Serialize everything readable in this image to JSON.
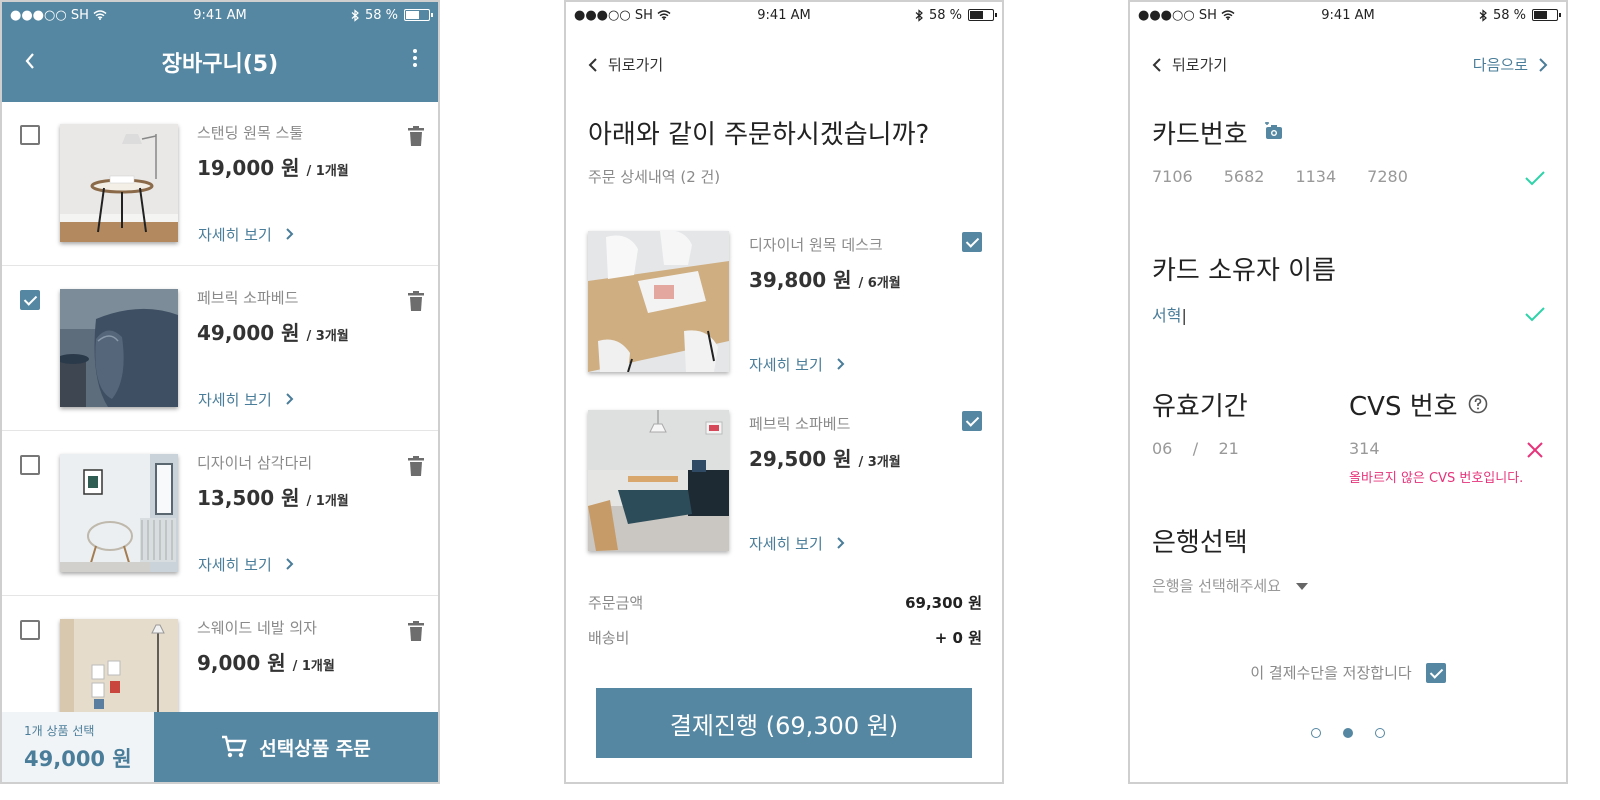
{
  "status_bar": {
    "carrier": "●●●○○ SH",
    "time": "9:41 AM",
    "battery": "58 %"
  },
  "cart": {
    "title": "장바구니(5)",
    "items": [
      {
        "name": "스탠딩 원목 스툴",
        "price": "19,000 원",
        "period": "/ 1개월",
        "detail": "자세히 보기",
        "checked": false
      },
      {
        "name": "페브릭 소파베드",
        "price": "49,000 원",
        "period": "/ 3개월",
        "detail": "자세히 보기",
        "checked": true
      },
      {
        "name": "디자이너 삼각다리",
        "price": "13,500 원",
        "period": "/ 1개월",
        "detail": "자세히 보기",
        "checked": false
      },
      {
        "name": "스웨이드 네발 의자",
        "price": "9,000 원",
        "period": "/ 1개월",
        "detail": "",
        "checked": false
      }
    ],
    "footer": {
      "selected_count": "1개 상품 선택",
      "selected_total": "49,000 원",
      "order_button": "선택상품 주문"
    }
  },
  "confirm": {
    "back": "뒤로가기",
    "heading": "아래와 같이 주문하시겠습니까?",
    "subheading": "주문 상세내역 (2 건)",
    "items": [
      {
        "name": "디자이너 원목 데스크",
        "price": "39,800 원",
        "period": "/ 6개월",
        "detail": "자세히 보기",
        "checked": true
      },
      {
        "name": "페브릭 소파베드",
        "price": "29,500 원",
        "period": "/ 3개월",
        "detail": "자세히 보기",
        "checked": true
      }
    ],
    "order_amount_label": "주문금액",
    "order_amount": "69,300 원",
    "shipping_label": "배송비",
    "shipping": "+ 0 원",
    "pay_button": "결제진행 (69,300 원)"
  },
  "payment": {
    "back": "뒤로가기",
    "next": "다음으로",
    "card_number_label": "카드번호",
    "card_number": [
      "7106",
      "5682",
      "1134",
      "7280"
    ],
    "owner_label": "카드 소유자 이름",
    "owner_value": "서혁",
    "expiry_label": "유효기간",
    "expiry_month": "06",
    "expiry_sep": "/",
    "expiry_year": "21",
    "cvs_label": "CVS 번호",
    "cvs_value": "314",
    "cvs_error": "올바르지 않은 CVS 번호입니다.",
    "bank_label": "은행선택",
    "bank_placeholder": "은행을 선택해주세요",
    "save_label": "이 결제수단을 저장합니다",
    "save_checked": true,
    "page_count": 3,
    "active_page": 2
  },
  "colors": {
    "primary": "#5587a2",
    "link": "#4a7d99",
    "success": "#2ed3a8",
    "error": "#e6337a"
  }
}
